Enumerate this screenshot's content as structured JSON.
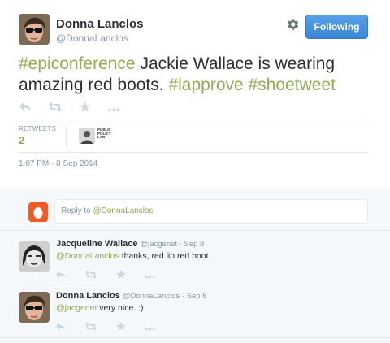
{
  "tweet": {
    "author_name": "Donna Lanclos",
    "author_handle": "@DonnaLanclos",
    "follow_label": "Following",
    "text_parts": {
      "h1": "#epiconference",
      "t1": " Jackie Wallace is wearing amazing red boots. ",
      "h2": "#lapprove",
      "t2": " ",
      "h3": "#shoetweet"
    },
    "retweets_label": "RETWEETS",
    "retweets_count": "2",
    "retweeter_logo": "PUBLIC POLICY LAB",
    "timestamp": "1:07 PM - 8 Sep 2014"
  },
  "reply_composer": {
    "prefix": "Reply to ",
    "mention": "@DonnaLanclos"
  },
  "replies": [
    {
      "name": "Jacqueline Wallace",
      "meta": "@jacgenet · Sep 8",
      "mention": "@DonnaLanclos",
      "text": " thanks, red lip red boot"
    },
    {
      "name": "Donna Lanclos",
      "meta": "@DonnaLanclos · Sep 8",
      "mention": "@jacgenet",
      "text": " very nice. :)"
    }
  ],
  "colors": {
    "accent": "#93ab55",
    "follow_button": "#4a90d9",
    "muted": "#8899a6",
    "reply_background": "#f5f8fa"
  },
  "icons": [
    "gear-icon",
    "reply-icon",
    "retweet-icon",
    "favorite-icon",
    "more-icon"
  ]
}
